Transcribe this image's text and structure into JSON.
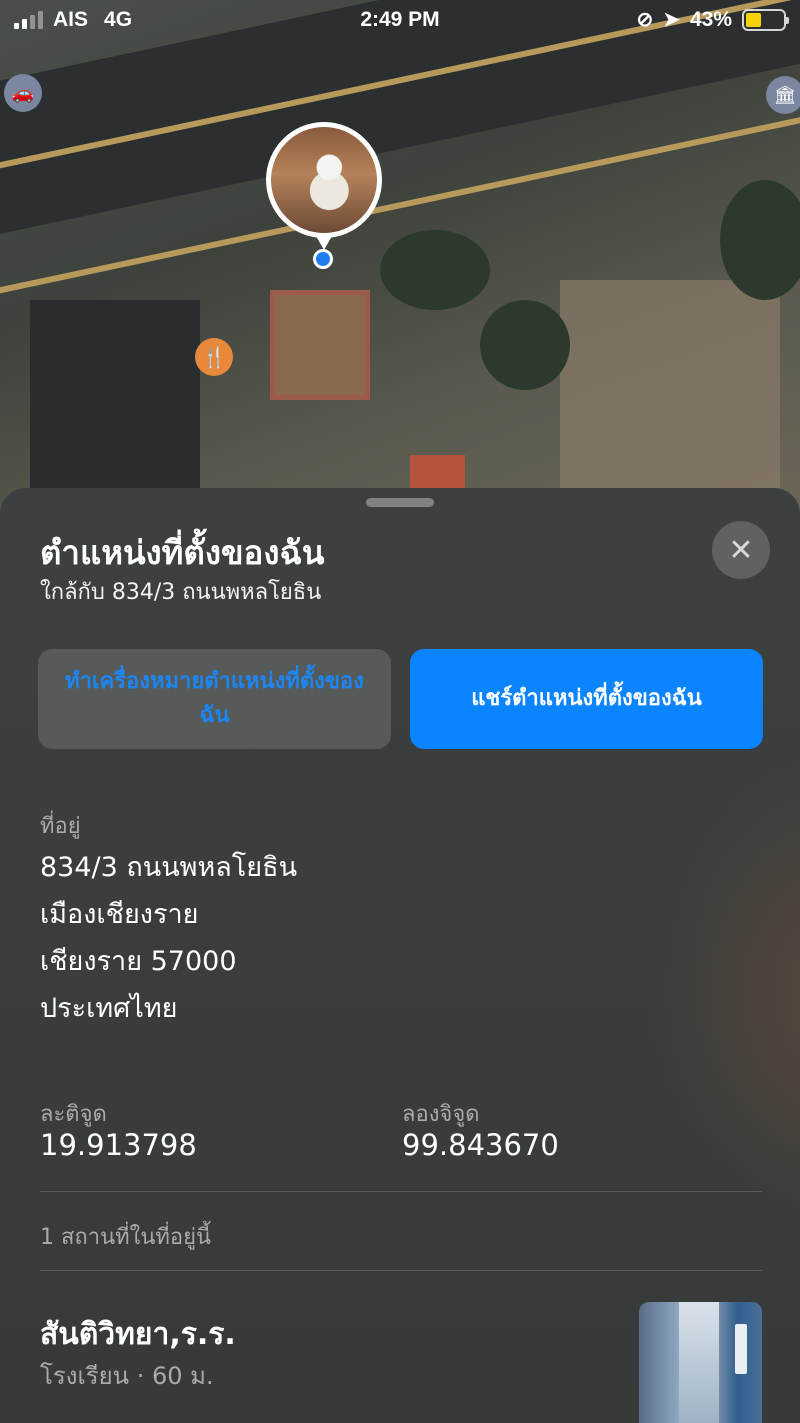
{
  "status_bar": {
    "carrier": "AIS",
    "network": "4G",
    "time": "2:49 PM",
    "battery": "43%",
    "battery_level": 0.43
  },
  "sheet": {
    "title": "ตำแหน่งที่ตั้งของฉัน",
    "subtitle": "ใกล้กับ 834/3 ถนนพหลโยธิน",
    "close_icon": "✕",
    "mark_location_button": "ทำเครื่องหมายตำแหน่งที่ตั้งของฉัน",
    "share_location_button": "แชร์ตำแหน่งที่ตั้งของฉัน",
    "address_label": "ที่อยู่",
    "address_lines": [
      "834/3 ถนนพหลโยธิน",
      "เมืองเชียงราย",
      "เชียงราย 57000",
      "ประเทศไทย"
    ],
    "latitude_label": "ละติจูด",
    "latitude": "19.913798",
    "longitude_label": "ลองจิจูด",
    "longitude": "99.843670",
    "places_count": "1 สถานที่ในที่อยู่นี้",
    "place": {
      "name": "สันติวิทยา,ร.ร.",
      "meta": "โรงเรียน · 60 ม."
    }
  },
  "map": {
    "icons": [
      "car-icon",
      "museum-icon",
      "restaurant-icon",
      "user-avatar",
      "current-location-dot"
    ],
    "accent_color": "#0a84ff"
  }
}
